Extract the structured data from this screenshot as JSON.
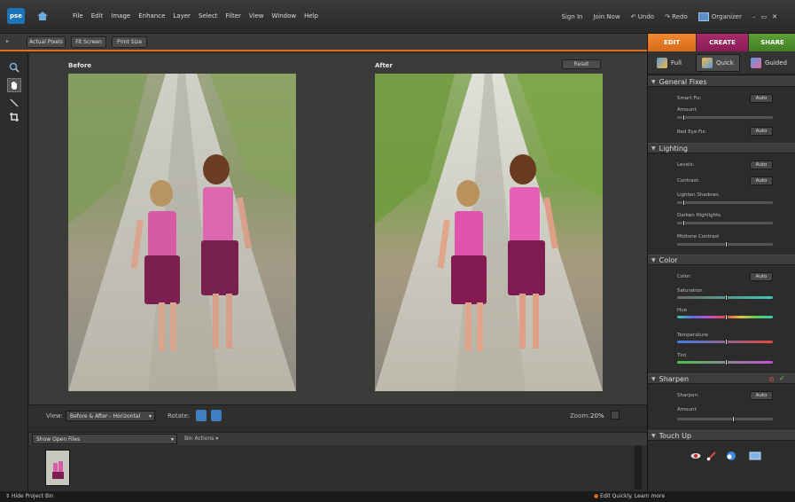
{
  "app": {
    "logo_text": "pse",
    "menu": [
      "File",
      "Edit",
      "Image",
      "Enhance",
      "Layer",
      "Select",
      "Filter",
      "View",
      "Window",
      "Help"
    ],
    "sign_in": "Sign In",
    "join_now": "Join Now",
    "undo": "Undo",
    "redo": "Redo",
    "organizer": "Organizer",
    "window_controls": [
      "–",
      "▭",
      "✕"
    ]
  },
  "options_bar": {
    "actual_pixels": "Actual Pixels",
    "fit_screen": "Fit Screen",
    "print_size": "Print Size"
  },
  "canvas": {
    "before_label": "Before",
    "after_label": "After",
    "reset_label": "Reset"
  },
  "view_bar": {
    "view_label": "View:",
    "view_value": "Before & After - Horizontal",
    "rotate_label": "Rotate:",
    "zoom_label": "Zoom:",
    "zoom_value": "20%"
  },
  "bin": {
    "show_label": "Show Open Files",
    "actions_label": "Bin Actions"
  },
  "status": {
    "hide_bin": "Hide Project Bin",
    "learn_more": "Edit Quickly. Learn more"
  },
  "panel": {
    "tabs": {
      "edit": "EDIT",
      "create": "CREATE",
      "share": "SHARE"
    },
    "subtabs": {
      "full": "Full",
      "quick": "Quick",
      "guided": "Guided"
    },
    "general_fixes": {
      "title": "General Fixes",
      "smart_fix": "Smart Fix:",
      "amount": "Amount",
      "red_eye": "Red Eye Fix:"
    },
    "lighting": {
      "title": "Lighting",
      "levels": "Levels:",
      "contrast": "Contrast:",
      "lighten_shadows": "Lighten Shadows",
      "darken_highlights": "Darken Highlights",
      "midtone_contrast": "Midtone Contrast"
    },
    "color": {
      "title": "Color",
      "color": "Color:",
      "saturation": "Saturation",
      "hue": "Hue",
      "temperature": "Temperature",
      "tint": "Tint"
    },
    "sharpen": {
      "title": "Sharpen",
      "sharpen": "Sharpen:",
      "amount": "Amount"
    },
    "touch_up": {
      "title": "Touch Up"
    },
    "auto_label": "Auto",
    "colors": {
      "edit_tab": "#e0751f",
      "create_tab": "#9a2460",
      "share_tab": "#4c8e2d",
      "accent": "#e36f1e"
    }
  }
}
